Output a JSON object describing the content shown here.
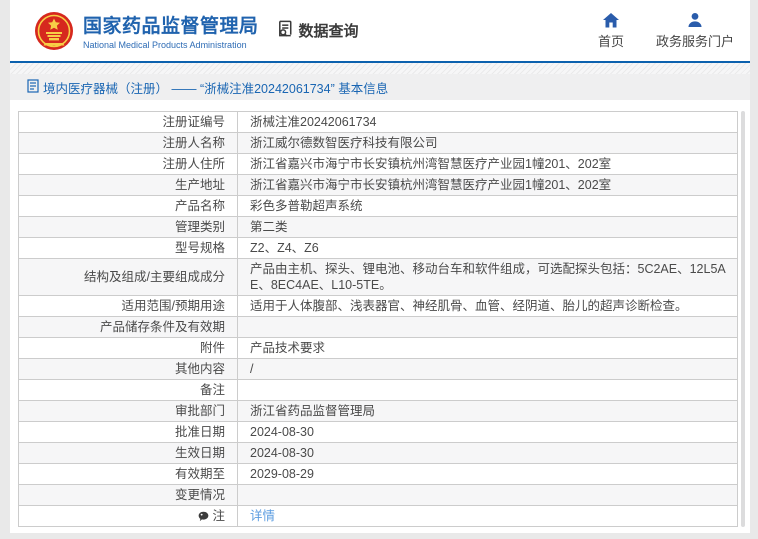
{
  "header": {
    "title_zh": "国家药品监督管理局",
    "title_en": "National Medical Products Administration",
    "data_query_label": "数据查询",
    "nav_items": [
      {
        "label": "首页",
        "icon": "home-icon"
      },
      {
        "label": "政务服务门户",
        "icon": "user-icon"
      }
    ]
  },
  "breadcrumb": {
    "icon": "document-icon",
    "text": "境内医疗器械（注册） —— “浙械注准20242061734” 基本信息"
  },
  "table": {
    "rows": [
      {
        "label": "注册证编号",
        "value": "浙械注准20242061734"
      },
      {
        "label": "注册人名称",
        "value": "浙江威尔德数智医疗科技有限公司"
      },
      {
        "label": "注册人住所",
        "value": "浙江省嘉兴市海宁市长安镇杭州湾智慧医疗产业园1幢201、202室"
      },
      {
        "label": "生产地址",
        "value": "浙江省嘉兴市海宁市长安镇杭州湾智慧医疗产业园1幢201、202室"
      },
      {
        "label": "产品名称",
        "value": "彩色多普勒超声系统"
      },
      {
        "label": "管理类别",
        "value": "第二类"
      },
      {
        "label": "型号规格",
        "value": "Z2、Z4、Z6"
      },
      {
        "label": "结构及组成/主要组成成分",
        "value": "产品由主机、探头、锂电池、移动台车和软件组成，可选配探头包括：5C2AE、12L5AE、8EC4AE、L10-5TE。"
      },
      {
        "label": "适用范围/预期用途",
        "value": "适用于人体腹部、浅表器官、神经肌骨、血管、经阴道、胎儿的超声诊断检查。"
      },
      {
        "label": "产品储存条件及有效期",
        "value": ""
      },
      {
        "label": "附件",
        "value": "产品技术要求"
      },
      {
        "label": "其他内容",
        "value": "/"
      },
      {
        "label": "备注",
        "value": ""
      },
      {
        "label": "审批部门",
        "value": "浙江省药品监督管理局"
      },
      {
        "label": "批准日期",
        "value": "2024-08-30"
      },
      {
        "label": "生效日期",
        "value": "2024-08-30"
      },
      {
        "label": "有效期至",
        "value": "2029-08-29"
      },
      {
        "label": "变更情况",
        "value": ""
      },
      {
        "label": "注",
        "label_icon": "comment-icon",
        "link": "详情"
      }
    ]
  },
  "colors": {
    "brand_blue": "#2063ae",
    "header_border_blue": "#0c61ae",
    "nav_icon_blue": "#2a5cab",
    "breadcrumb_text_blue": "#1a66b3",
    "link_blue": "#5b9ce0",
    "row_alt_bg": "#f6f6f7",
    "table_border": "#cccccc",
    "text_gray": "#4a4a4a",
    "page_bg": "#e9e9e9"
  }
}
